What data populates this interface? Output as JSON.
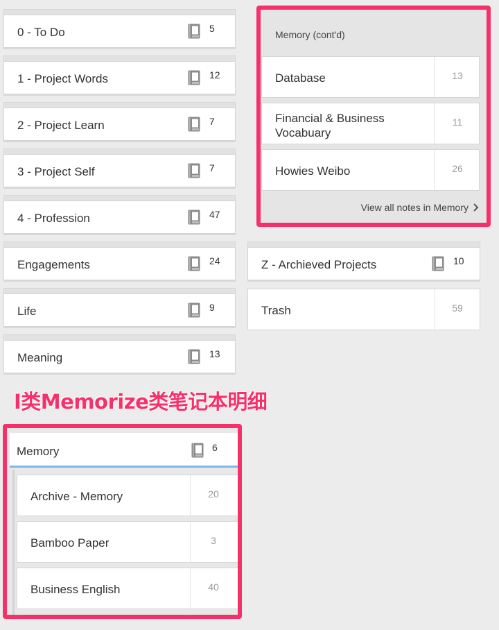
{
  "stacks": [
    {
      "name": "0 - To Do",
      "count": "5"
    },
    {
      "name": "1 - Project Words",
      "count": "12"
    },
    {
      "name": "2 - Project Learn",
      "count": "7"
    },
    {
      "name": "3 - Project Self",
      "count": "7"
    },
    {
      "name": "4 - Profession",
      "count": "47"
    },
    {
      "name": "Engagements",
      "count": "24"
    },
    {
      "name": "Life",
      "count": "9"
    },
    {
      "name": "Meaning",
      "count": "13"
    }
  ],
  "memory_contd": {
    "title": "Memory (cont'd)",
    "notebooks": [
      {
        "name": "Database",
        "count": "13"
      },
      {
        "name": "Financial & Business Vocabuary",
        "count": "11"
      },
      {
        "name": "Howies Weibo",
        "count": "26"
      }
    ],
    "view_all": "View all notes in Memory"
  },
  "archived_stack": {
    "name": "Z - Archieved Projects",
    "count": "10"
  },
  "trash": {
    "name": "Trash",
    "count": "59"
  },
  "annotation": "I类Memorize类笔记本明细",
  "memory_stack": {
    "name": "Memory",
    "count": "6",
    "notebooks": [
      {
        "name": "Archive - Memory",
        "count": "20"
      },
      {
        "name": "Bamboo Paper",
        "count": "3"
      },
      {
        "name": "Business English",
        "count": "40"
      }
    ]
  },
  "colors": {
    "highlight": "#f5306a",
    "selection_line": "#7db8e8",
    "background": "#ececec"
  },
  "icons": {
    "stack": "notebook-stack-icon",
    "view_all": "chevron-right-icon"
  }
}
